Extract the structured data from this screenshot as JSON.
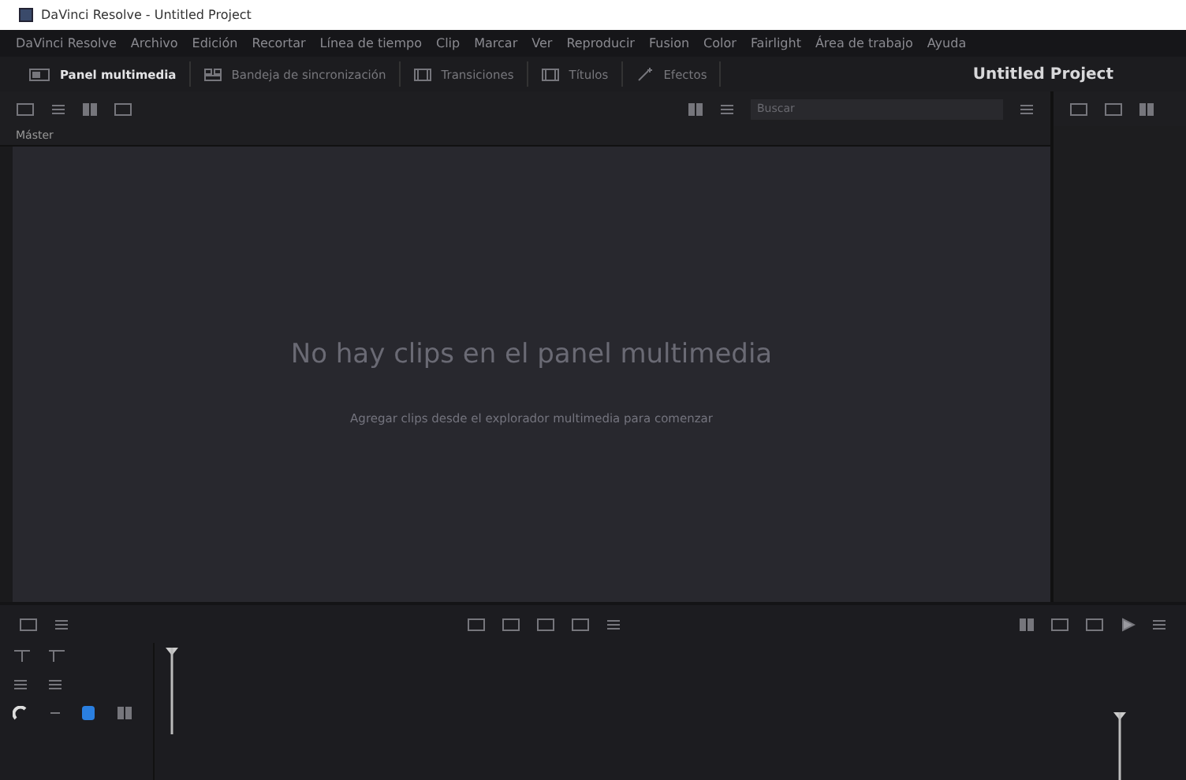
{
  "window": {
    "title": "DaVinci Resolve - Untitled Project"
  },
  "menu": [
    "DaVinci Resolve",
    "Archivo",
    "Edición",
    "Recortar",
    "Línea de tiempo",
    "Clip",
    "Marcar",
    "Ver",
    "Reproducir",
    "Fusion",
    "Color",
    "Fairlight",
    "Área de trabajo",
    "Ayuda"
  ],
  "tabs": [
    {
      "label": "Panel multimedia",
      "selected": true,
      "kind": "media"
    },
    {
      "label": "Bandeja de sincronización",
      "selected": false,
      "kind": "sync"
    },
    {
      "label": "Transiciones",
      "selected": false,
      "kind": "film"
    },
    {
      "label": "Títulos",
      "selected": false,
      "kind": "film"
    },
    {
      "label": "Efectos",
      "selected": false,
      "kind": "fx"
    }
  ],
  "project_name": "Untitled Project",
  "search": {
    "placeholder": "Buscar"
  },
  "bin": {
    "name": "Máster"
  },
  "empty_state": {
    "title": "No hay clips en el panel multimedia",
    "hint": "Agregar clips desde el explorador multimedia para comenzar"
  },
  "timeline": {
    "snapping": true
  }
}
